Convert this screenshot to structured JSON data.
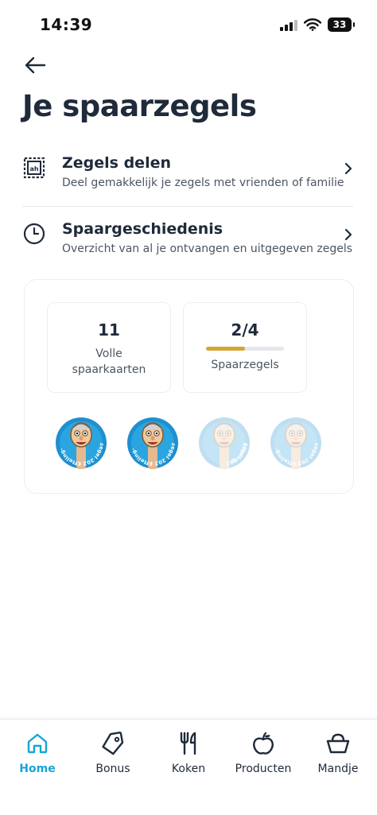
{
  "status_bar": {
    "time": "14:39",
    "battery": "33"
  },
  "page": {
    "title": "Je spaarzegels"
  },
  "menu": [
    {
      "title": "Zegels delen",
      "subtitle": "Deel gemakkelijk je zegels met vrienden of familie",
      "icon": "stamp-share-icon"
    },
    {
      "title": "Spaargeschiedenis",
      "subtitle": "Overzicht van al je ontvangen en uitgegeven zegels",
      "icon": "clock-icon"
    }
  ],
  "stats": {
    "cards": {
      "value": "11",
      "label_line1": "Volle",
      "label_line2": "spaarkaarten"
    },
    "stamps": {
      "value": "2/4",
      "label": "Spaarzegels",
      "progress": 0.5
    }
  },
  "stamps": {
    "collected": 2,
    "total": 4,
    "text": "Efteling-zegel 2026"
  },
  "colors": {
    "accent": "#18a3d8",
    "progress": "#d4a437",
    "title": "#1f2a3a"
  },
  "tabs": [
    {
      "label": "Home",
      "icon": "home-icon",
      "active": true
    },
    {
      "label": "Bonus",
      "icon": "tag-icon",
      "active": false
    },
    {
      "label": "Koken",
      "icon": "cutlery-icon",
      "active": false
    },
    {
      "label": "Producten",
      "icon": "apple-icon",
      "active": false
    },
    {
      "label": "Mandje",
      "icon": "basket-icon",
      "active": false
    }
  ]
}
